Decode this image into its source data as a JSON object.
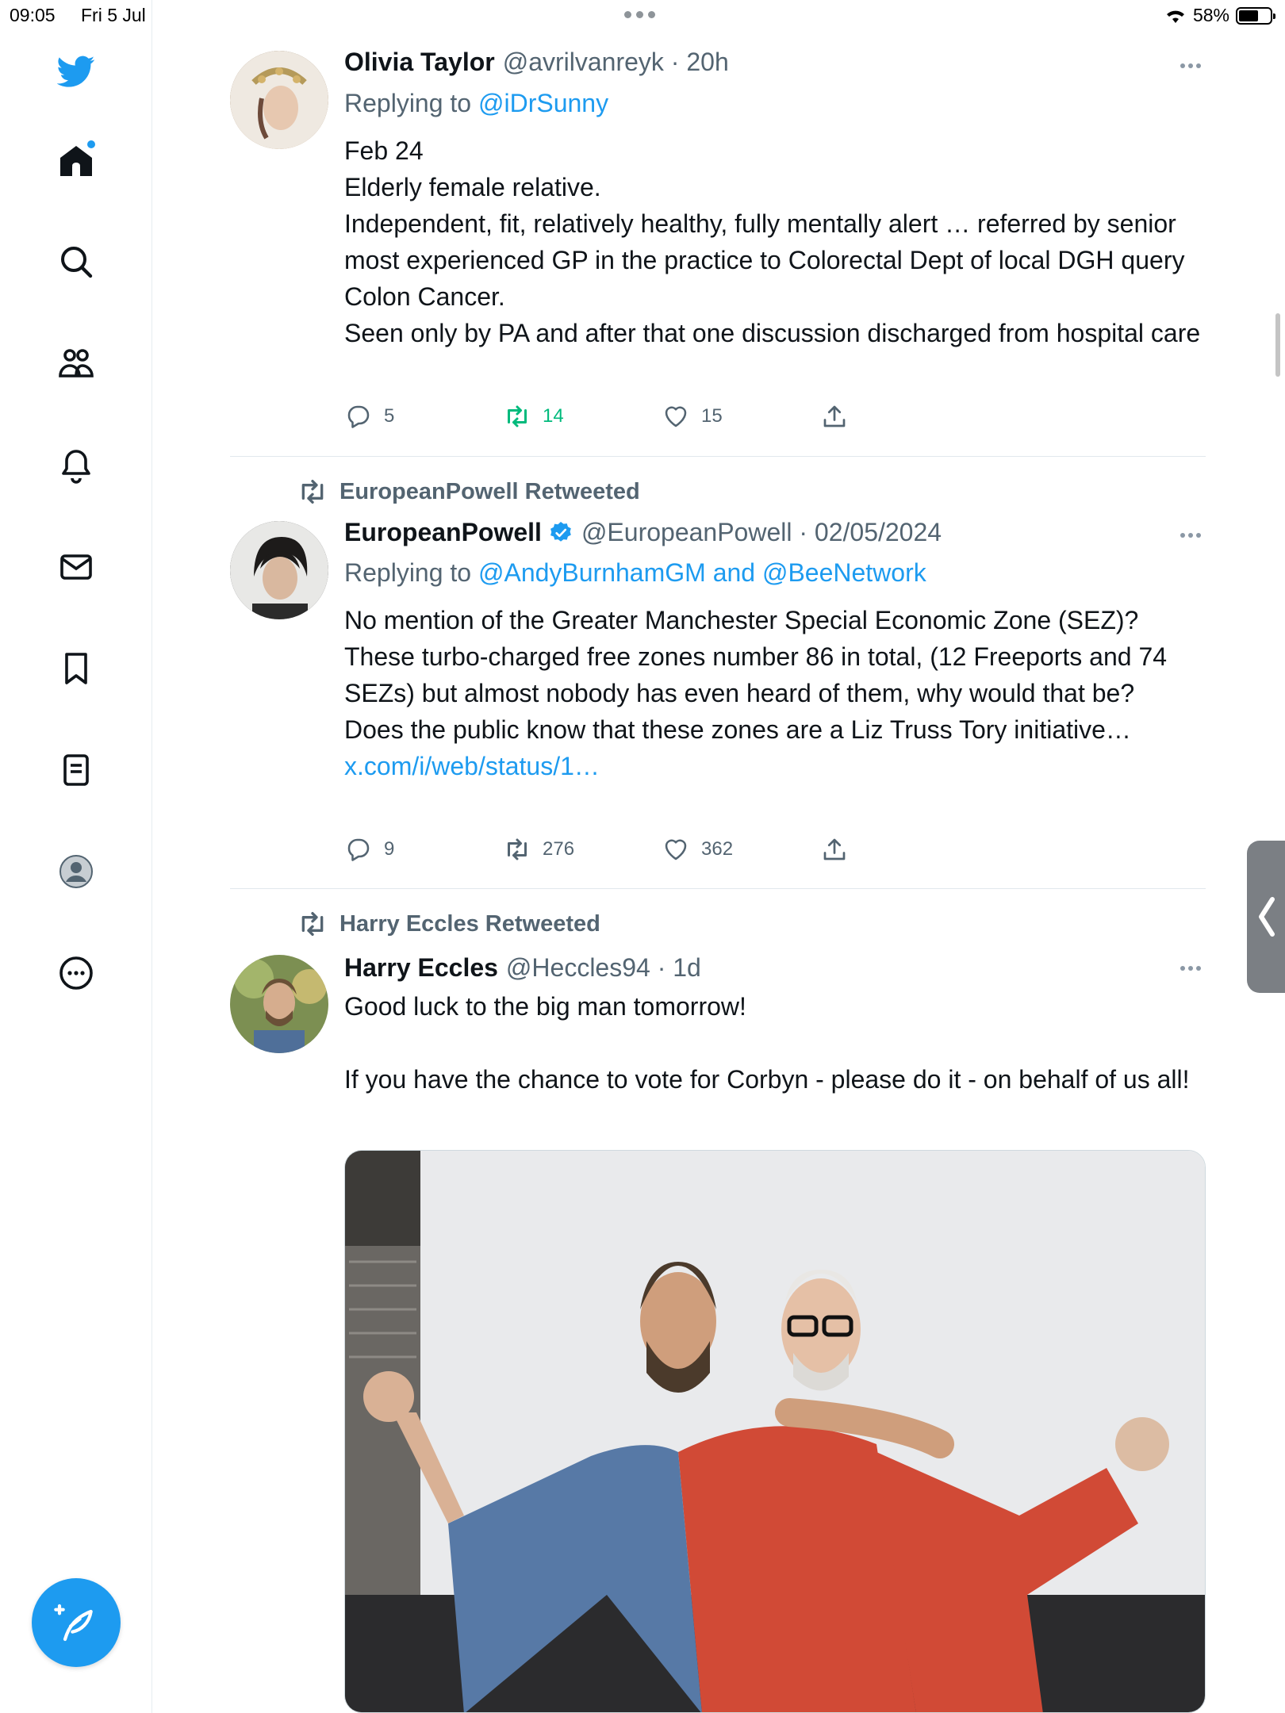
{
  "status_bar": {
    "time": "09:05",
    "date": "Fri 5 Jul",
    "battery": "58%"
  },
  "nav": {
    "items": [
      "twitter-logo",
      "home",
      "search",
      "communities",
      "notifications",
      "messages",
      "bookmarks",
      "lists",
      "profile",
      "more"
    ]
  },
  "tweets": [
    {
      "name": "Olivia Taylor",
      "handle": "@avrilvanreyk · 20h",
      "reply_prefix": "Replying to ",
      "reply_to": "@iDrSunny",
      "text": "Feb 24\nElderly female relative.\nIndependent, fit, relatively healthy, fully mentally alert … referred by senior most experienced GP in the practice to Colorectal Dept of local DGH query Colon Cancer.\nSeen only by PA and after that one discussion discharged from hospital care",
      "replies": "5",
      "retweets": "14",
      "likes": "15"
    },
    {
      "retweeted_by": "EuropeanPowell Retweeted",
      "name": "EuropeanPowell",
      "handle": "@EuropeanPowell · 02/05/2024",
      "reply_prefix": "Replying to ",
      "reply_to": "@AndyBurnhamGM and @BeeNetwork",
      "text": "No mention of the Greater Manchester Special Economic Zone (SEZ)? These turbo-charged free zones number 86 in total, (12 Freeports and 74 SEZs) but almost nobody has even heard of them, why would that be?\nDoes the public know that these zones are a Liz Truss Tory initiative…",
      "link": "x.com/i/web/status/1…",
      "replies": "9",
      "retweets": "276",
      "likes": "362"
    },
    {
      "retweeted_by": "Harry Eccles Retweeted",
      "name": "Harry Eccles",
      "handle": "@Heccles94 · 1d",
      "text": "Good luck to the big man tomorrow!\n\nIf you have the chance to vote for Corbyn - please do it - on behalf of us all!"
    }
  ],
  "colors": {
    "accent": "#1d9bf0",
    "retweet_green": "#00ba7c",
    "secondary_text": "#536471"
  }
}
